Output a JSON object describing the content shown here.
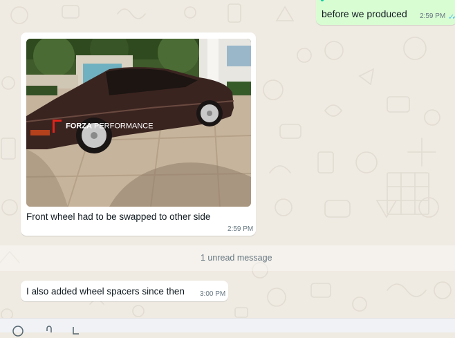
{
  "chat": {
    "messages": [
      {
        "direction": "outgoing",
        "text": "before we produced",
        "time": "2:59 PM",
        "status": "read",
        "status_color": "#53bdeb"
      },
      {
        "direction": "incoming",
        "type": "image",
        "caption": "Front wheel had to be swapped to other side",
        "time": "2:59 PM",
        "image_watermark": {
          "brand_bold": "FORZA",
          "brand_light": " PERFORMANCE",
          "brand_color": "#e2231a"
        }
      },
      {
        "direction": "incoming",
        "text": "I also added wheel spacers since then",
        "time": "3:00 PM"
      }
    ],
    "unread_divider": "1 unread message"
  },
  "composer": {
    "icons": [
      "emoji-icon",
      "attach-icon",
      "sticker-icon"
    ]
  },
  "colors": {
    "wallpaper": "#efeae2",
    "outgoing_bubble": "#d9fdd3",
    "incoming_bubble": "#ffffff",
    "meta_text": "#667781"
  }
}
